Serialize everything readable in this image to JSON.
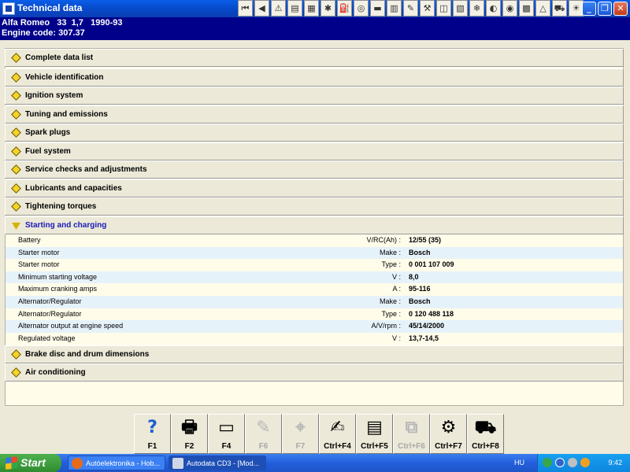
{
  "window": {
    "title": "Technical data",
    "toolbar_icons": [
      "first-icon",
      "prev-icon",
      "warning-icon",
      "notes-icon",
      "engine-icon",
      "spark-icon",
      "fuel-icon",
      "wheel-icon",
      "battery-icon",
      "diagnostic-icon",
      "tools-icon",
      "wrench-icon",
      "filter-icon",
      "oil-icon",
      "ac-icon",
      "belt-icon",
      "brake-icon",
      "lift-icon",
      "alert-icon",
      "car-icon",
      "light-icon"
    ],
    "toolbar_glyphs": [
      "⏮",
      "◀",
      "⚠",
      "▤",
      "▦",
      "✱",
      "⛽",
      "◎",
      "▬",
      "▥",
      "✎",
      "⚒",
      "◫",
      "▧",
      "❄",
      "◐",
      "◉",
      "▩",
      "△",
      "⛟",
      "☀"
    ],
    "controls": [
      "_",
      "❐",
      "✕"
    ]
  },
  "vehicle": {
    "line1": "Alfa Romeo   33  1,7   1990-93",
    "line2": "Engine code: 307.37"
  },
  "sections": [
    {
      "label": "Complete data list"
    },
    {
      "label": "Vehicle identification"
    },
    {
      "label": "Ignition system"
    },
    {
      "label": "Tuning and emissions"
    },
    {
      "label": "Spark plugs"
    },
    {
      "label": "Fuel system"
    },
    {
      "label": "Service checks and adjustments"
    },
    {
      "label": "Lubricants and capacities"
    },
    {
      "label": "Tightening torques"
    },
    {
      "label": "Starting and charging"
    },
    {
      "label": "Brake disc and drum dimensions"
    },
    {
      "label": "Air conditioning"
    }
  ],
  "starting_charging_rows": [
    {
      "name": "Battery",
      "unit": "V/RC(Ah) :",
      "value": "12/55 (35)"
    },
    {
      "name": "Starter motor",
      "unit": "Make :",
      "value": "Bosch"
    },
    {
      "name": "Starter motor",
      "unit": "Type :",
      "value": "0 001 107 009"
    },
    {
      "name": "Minimum starting voltage",
      "unit": "V :",
      "value": "8,0"
    },
    {
      "name": "Maximum cranking amps",
      "unit": "A :",
      "value": "95-116"
    },
    {
      "name": "Alternator/Regulator",
      "unit": "Make :",
      "value": "Bosch"
    },
    {
      "name": "Alternator/Regulator",
      "unit": "Type :",
      "value": "0 120 488 118"
    },
    {
      "name": "Alternator output at engine speed",
      "unit": "A/V/rpm :",
      "value": "45/14/2000"
    },
    {
      "name": "Regulated voltage",
      "unit": "V :",
      "value": "13,7-14,5"
    }
  ],
  "function_keys": [
    {
      "label": "F1",
      "icon": "help-icon",
      "glyph": "?",
      "disabled": false
    },
    {
      "label": "F2",
      "icon": "printer-icon",
      "glyph": "🖶",
      "disabled": false
    },
    {
      "label": "F4",
      "icon": "screen-icon",
      "glyph": "▭",
      "disabled": false
    },
    {
      "label": "F6",
      "icon": "text-graphic-icon",
      "glyph": "✎",
      "disabled": true
    },
    {
      "label": "F7",
      "icon": "pointer-icon",
      "glyph": "⌖",
      "disabled": true
    },
    {
      "label": "Ctrl+F4",
      "icon": "notepad-icon",
      "glyph": "✍",
      "disabled": false
    },
    {
      "label": "Ctrl+F5",
      "icon": "book-icon",
      "glyph": "▤",
      "disabled": false
    },
    {
      "label": "Ctrl+F6",
      "icon": "compare-icon",
      "glyph": "⧉",
      "disabled": true
    },
    {
      "label": "Ctrl+F7",
      "icon": "wheel-gauge-icon",
      "glyph": "⚙",
      "disabled": false
    },
    {
      "label": "Ctrl+F8",
      "icon": "lift-icon",
      "glyph": "⛟",
      "disabled": false
    }
  ],
  "taskbar": {
    "start": "Start",
    "tasks": [
      {
        "label": "Autóelektronika - Hob...",
        "icon": "firefox-icon"
      },
      {
        "label": "Autodata CD3 - [Mod...",
        "icon": "autodata-icon"
      }
    ],
    "lang": "HU",
    "clock": "9:42"
  }
}
